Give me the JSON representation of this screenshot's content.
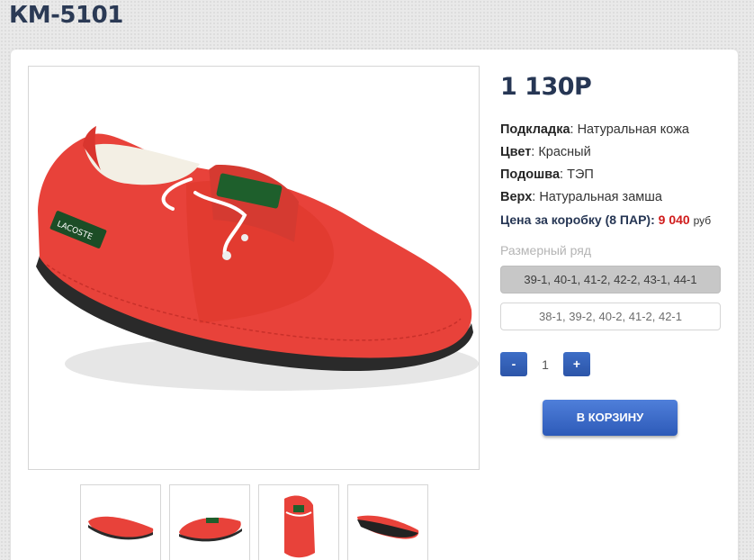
{
  "page": {
    "title": "КМ-5101"
  },
  "product": {
    "price": "1 130Р",
    "specs": [
      {
        "label": "Подкладка",
        "value": ": Натуральная кожа"
      },
      {
        "label": "Цвет",
        "value": ": Красный"
      },
      {
        "label": "Подошва",
        "value": ": ТЭП"
      },
      {
        "label": "Верх",
        "value": ": Натуральная замша"
      }
    ],
    "box_price": {
      "label": "Цена за коробку (8 ПАР):",
      "value": "9 040",
      "currency": "руб"
    },
    "size_label": "Размерный ряд",
    "sizes": [
      {
        "label": "39-1, 40-1, 41-2, 42-2, 43-1, 44-1",
        "selected": true
      },
      {
        "label": "38-1, 39-2, 40-2, 41-2, 42-1",
        "selected": false
      }
    ],
    "quantity": {
      "value": "1",
      "minus": "-",
      "plus": "+"
    },
    "cart_button": "В КОРЗИНУ",
    "image": {
      "brand_tag": "LACOSTE"
    }
  },
  "colors": {
    "accent_blue": "#2d5ab8",
    "title_navy": "#263654",
    "price_red": "#d01c1c",
    "shoe_red": "#e8423a"
  }
}
